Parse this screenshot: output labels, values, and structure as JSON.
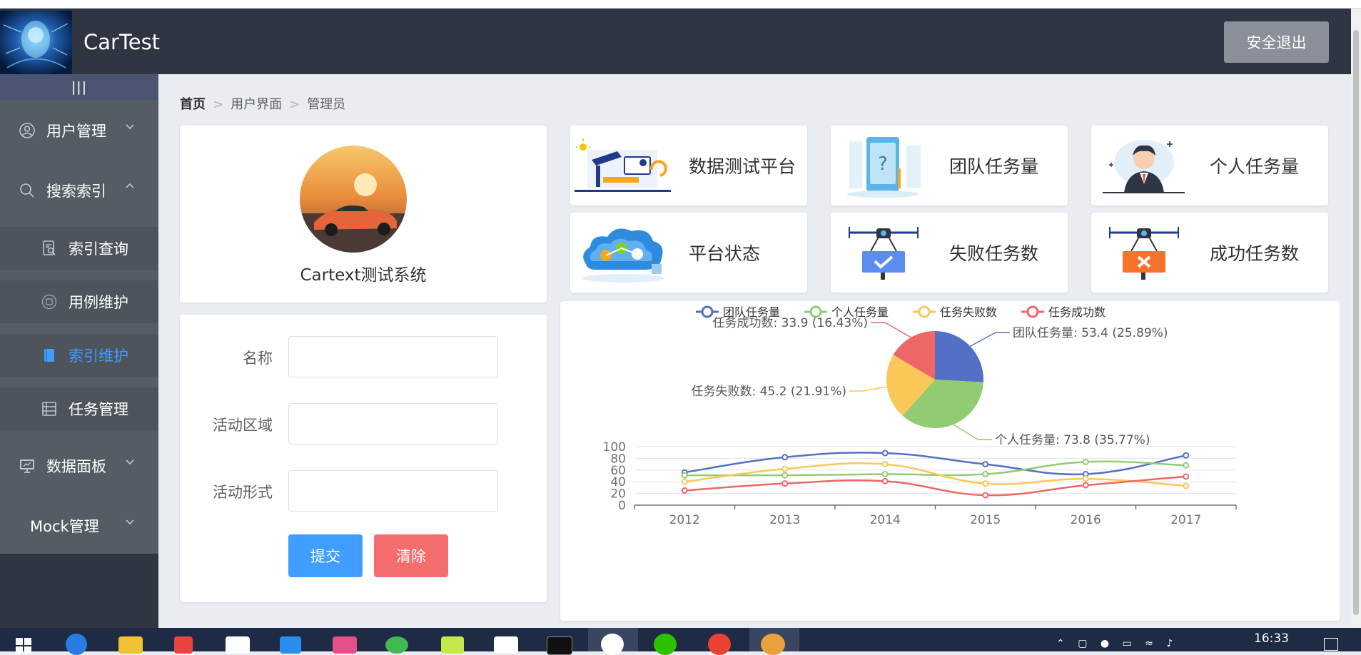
{
  "header": {
    "app_title": "CarTest",
    "logout_label": "安全退出"
  },
  "sidebar": {
    "toggle_glyph": "|||",
    "items": [
      {
        "label": "用户管理",
        "icon": "user-icon",
        "expanded": false
      },
      {
        "label": "搜索索引",
        "icon": "search-icon",
        "expanded": true
      },
      {
        "label": "数据面板",
        "icon": "monitor-icon",
        "expanded": false
      },
      {
        "label": "Mock管理",
        "icon": "",
        "expanded": false
      }
    ],
    "subitems": [
      {
        "label": "索引查询",
        "icon": "doc-search-icon",
        "active": false
      },
      {
        "label": "用例维护",
        "icon": "circle-icon",
        "active": false
      },
      {
        "label": "索引维护",
        "icon": "book-icon",
        "active": true
      },
      {
        "label": "任务管理",
        "icon": "list-icon",
        "active": false
      }
    ]
  },
  "breadcrumb": {
    "home": "首页",
    "level1": "用户界面",
    "level2": "管理员"
  },
  "profile": {
    "name": "Cartext测试系统"
  },
  "form": {
    "fields": [
      {
        "label": "名称",
        "value": "",
        "placeholder": ""
      },
      {
        "label": "活动区域",
        "value": "",
        "placeholder": ""
      },
      {
        "label": "活动形式",
        "value": "",
        "placeholder": ""
      }
    ],
    "submit_label": "提交",
    "clear_label": "清除"
  },
  "stats": [
    {
      "label": "数据测试平台"
    },
    {
      "label": "团队任务量"
    },
    {
      "label": "个人任务量"
    },
    {
      "label": "平台状态"
    },
    {
      "label": "失败任务数"
    },
    {
      "label": "成功任务数"
    }
  ],
  "colors": {
    "blue": "#5470c6",
    "green": "#91cc75",
    "yellow": "#fac858",
    "red": "#ee6666",
    "primary": "#409eff",
    "danger": "#f56c6c"
  },
  "chart_data": [
    {
      "type": "pie",
      "legend": [
        "团队任务量",
        "个人任务量",
        "任务失败数",
        "任务成功数"
      ],
      "legend_position": "top",
      "slices": [
        {
          "name": "团队任务量",
          "value": 53.4,
          "label": "团队任务量: 53.4 (25.89%)"
        },
        {
          "name": "个人任务量",
          "value": 73.8,
          "label": "个人任务量: 73.8 (35.77%)"
        },
        {
          "name": "任务失败数",
          "value": 45.2,
          "label": "任务失败数: 45.2 (21.91%)"
        },
        {
          "name": "任务成功数",
          "value": 33.9,
          "label": "任务成功数: 33.9 (16.43%)"
        }
      ]
    },
    {
      "type": "line",
      "categories": [
        "2012",
        "2013",
        "2014",
        "2015",
        "2016",
        "2017"
      ],
      "y_ticks": [
        "0",
        "20",
        "40",
        "60",
        "80",
        "100"
      ],
      "ylim": [
        0,
        100
      ],
      "grid": true,
      "series": [
        {
          "name": "团队任务量",
          "values": [
            56,
            82,
            89,
            70,
            53,
            85
          ]
        },
        {
          "name": "个人任务量",
          "values": [
            51,
            51,
            53,
            53,
            74,
            68
          ]
        },
        {
          "name": "任务失败数",
          "values": [
            40,
            62,
            70,
            37,
            45,
            33
          ]
        },
        {
          "name": "任务成功数",
          "values": [
            25,
            37,
            41,
            17,
            34,
            49
          ]
        }
      ]
    }
  ],
  "taskbar": {
    "clock": "16:33"
  }
}
